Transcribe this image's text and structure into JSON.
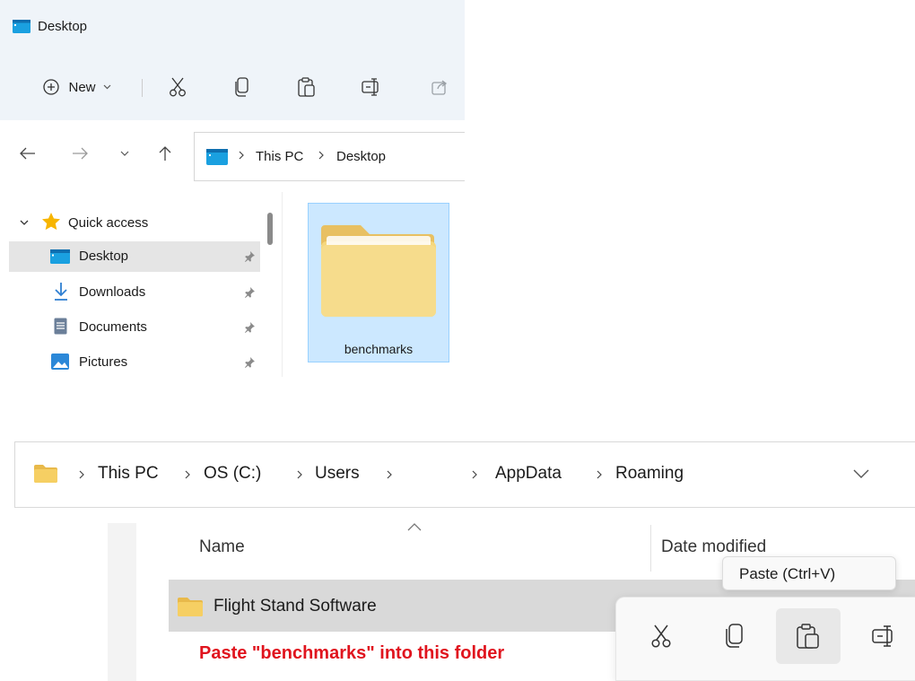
{
  "top_window": {
    "title": "Desktop",
    "toolbar": {
      "new_label": "New"
    },
    "address": {
      "crumbs": [
        "This PC",
        "Desktop"
      ]
    },
    "sidebar": {
      "quick_access": "Quick access",
      "items": [
        {
          "label": "Desktop",
          "selected": true
        },
        {
          "label": "Downloads"
        },
        {
          "label": "Documents"
        },
        {
          "label": "Pictures"
        }
      ]
    },
    "selected_folder": "benchmarks"
  },
  "bottom_window": {
    "address": {
      "crumbs": [
        "This PC",
        "OS (C:)",
        "Users",
        "AppData",
        "Roaming"
      ]
    },
    "columns": {
      "name": "Name",
      "date": "Date modified"
    },
    "rows": [
      {
        "name": "Flight Stand Software",
        "selected": true
      }
    ],
    "instruction": "Paste \"benchmarks\" into this folder",
    "tooltip": "Paste (Ctrl+V)"
  },
  "colors": {
    "accent": "#0067c0",
    "selection": "#cce8ff",
    "instruction_red": "#e0141e",
    "folder_yellow": "#f4d27a"
  }
}
